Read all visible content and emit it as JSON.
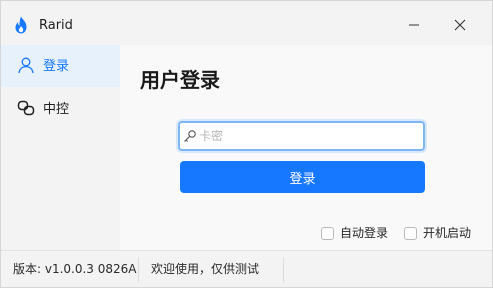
{
  "window": {
    "title": "Rarid",
    "app_icon": "flame-icon",
    "minimize_icon": "minimize-icon",
    "close_icon": "close-icon"
  },
  "sidebar": {
    "items": [
      {
        "label": "登录",
        "icon": "user-icon",
        "active": true
      },
      {
        "label": "中控",
        "icon": "link-icon",
        "active": false
      }
    ]
  },
  "main": {
    "title": "用户登录",
    "card_input": {
      "placeholder": "卡密",
      "value": "",
      "icon": "key-icon"
    },
    "login_button": "登录",
    "options": [
      {
        "label": "自动登录",
        "checked": false
      },
      {
        "label": "开机启动",
        "checked": false
      }
    ]
  },
  "status": {
    "version": "版本: v1.0.0.3 0826A",
    "message": "欢迎使用，仅供测试"
  },
  "colors": {
    "accent": "#1677ff",
    "nav_active_bg": "#e6f1fb",
    "input_focus_border": "#7fb4f5",
    "app_icon": "#1677ff"
  }
}
